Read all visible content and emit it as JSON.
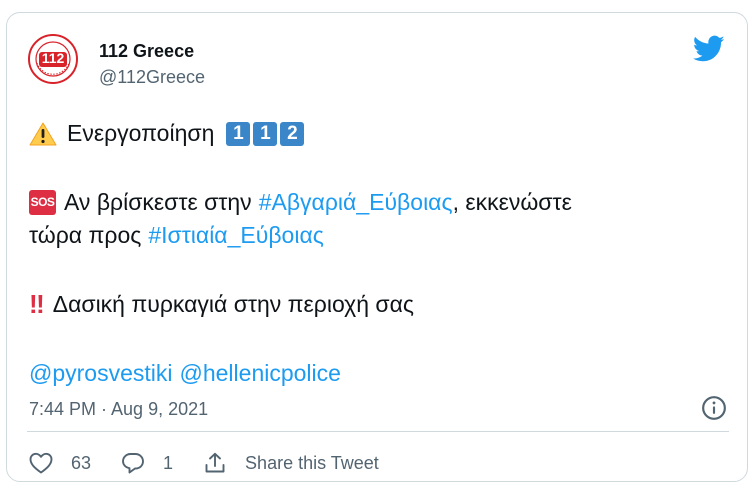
{
  "account": {
    "name": "112 Greece",
    "handle": "@112Greece",
    "avatar_text": "112",
    "avatar_ring_text": "ΠΟΛΙΤΙΚΗ ΠΡΟΣΤΑΣΙΑ ΕΚΤΑΚΤΗΣ ΑΝΑΓΚΗΣ"
  },
  "tweet": {
    "line1": {
      "emoji": "warning-icon",
      "text": "Ενεργοποίηση",
      "keycaps": [
        "1",
        "1",
        "2"
      ]
    },
    "line2": {
      "badge": "SOS",
      "text_before": "Αν βρίσκεστε στην",
      "hashtag": "#Αβγαριά_Εύβοιας",
      "text_after": ", εκκενώστε"
    },
    "line3": {
      "text_before": "τώρα προς",
      "hashtag": "#Ιστιαία_Εύβοιας"
    },
    "line4": {
      "emoji": "double-exclamation-icon",
      "mark": "‼",
      "text": "Δασική πυρκαγιά στην περιοχή σας"
    },
    "mentions": [
      "@pyrosvestiki",
      "@hellenicpolice"
    ]
  },
  "timestamp": "7:44 PM · Aug 9, 2021",
  "actions": {
    "likes": "63",
    "replies": "1",
    "share_label": "Share this Tweet"
  },
  "colors": {
    "link": "#1d9bf0",
    "twitter_blue": "#1d9bf0",
    "muted": "#536471",
    "sos_red": "#dd2e44",
    "keycap_blue": "#3a86c8"
  }
}
